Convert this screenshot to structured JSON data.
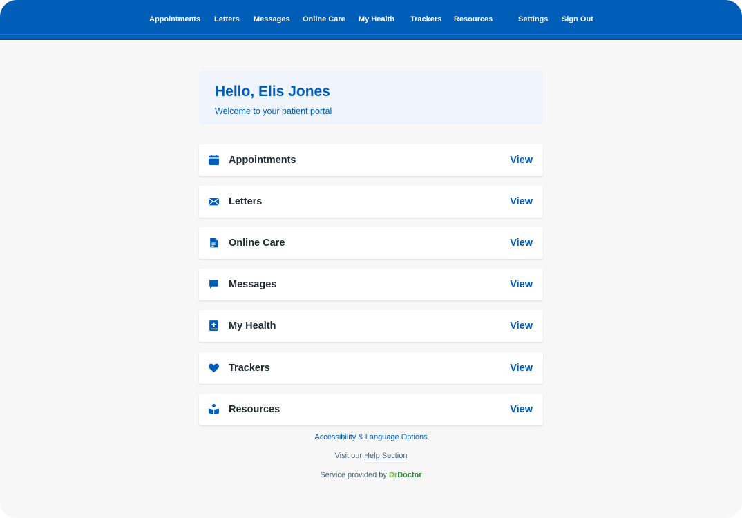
{
  "nav": {
    "items": [
      {
        "label": "Appointments"
      },
      {
        "label": "Letters"
      },
      {
        "label": "Messages"
      },
      {
        "label": "Online Care"
      },
      {
        "label": "My Health"
      },
      {
        "label": "Trackers"
      },
      {
        "label": "Resources"
      }
    ],
    "settings_label": "Settings",
    "signout_label": "Sign Out"
  },
  "welcome": {
    "greeting": "Hello, Elis Jones",
    "subtitle": "Welcome to your patient portal"
  },
  "cards": [
    {
      "label": "Appointments",
      "action": "View",
      "icon": "calendar-icon"
    },
    {
      "label": "Letters",
      "action": "View",
      "icon": "envelope-icon"
    },
    {
      "label": "Online Care",
      "action": "View",
      "icon": "document-icon"
    },
    {
      "label": "Messages",
      "action": "View",
      "icon": "chat-bubble-icon"
    },
    {
      "label": "My Health",
      "action": "View",
      "icon": "medical-book-icon"
    },
    {
      "label": "Trackers",
      "action": "View",
      "icon": "heart-icon"
    },
    {
      "label": "Resources",
      "action": "View",
      "icon": "reading-person-icon"
    }
  ],
  "footer": {
    "accessibility_label": "Accessibility & Language Options",
    "help_prefix": "Visit our ",
    "help_link": "Help Section",
    "provided_prefix": "Service provided by ",
    "brand_dr": "Dr",
    "brand_doctor": "Doctor"
  },
  "colors": {
    "primary": "#005eb8",
    "background": "#f7f7f7",
    "welcome_bg": "#eef4f9",
    "text_dark": "#212b32",
    "brand_green": "#2e8b3a"
  }
}
